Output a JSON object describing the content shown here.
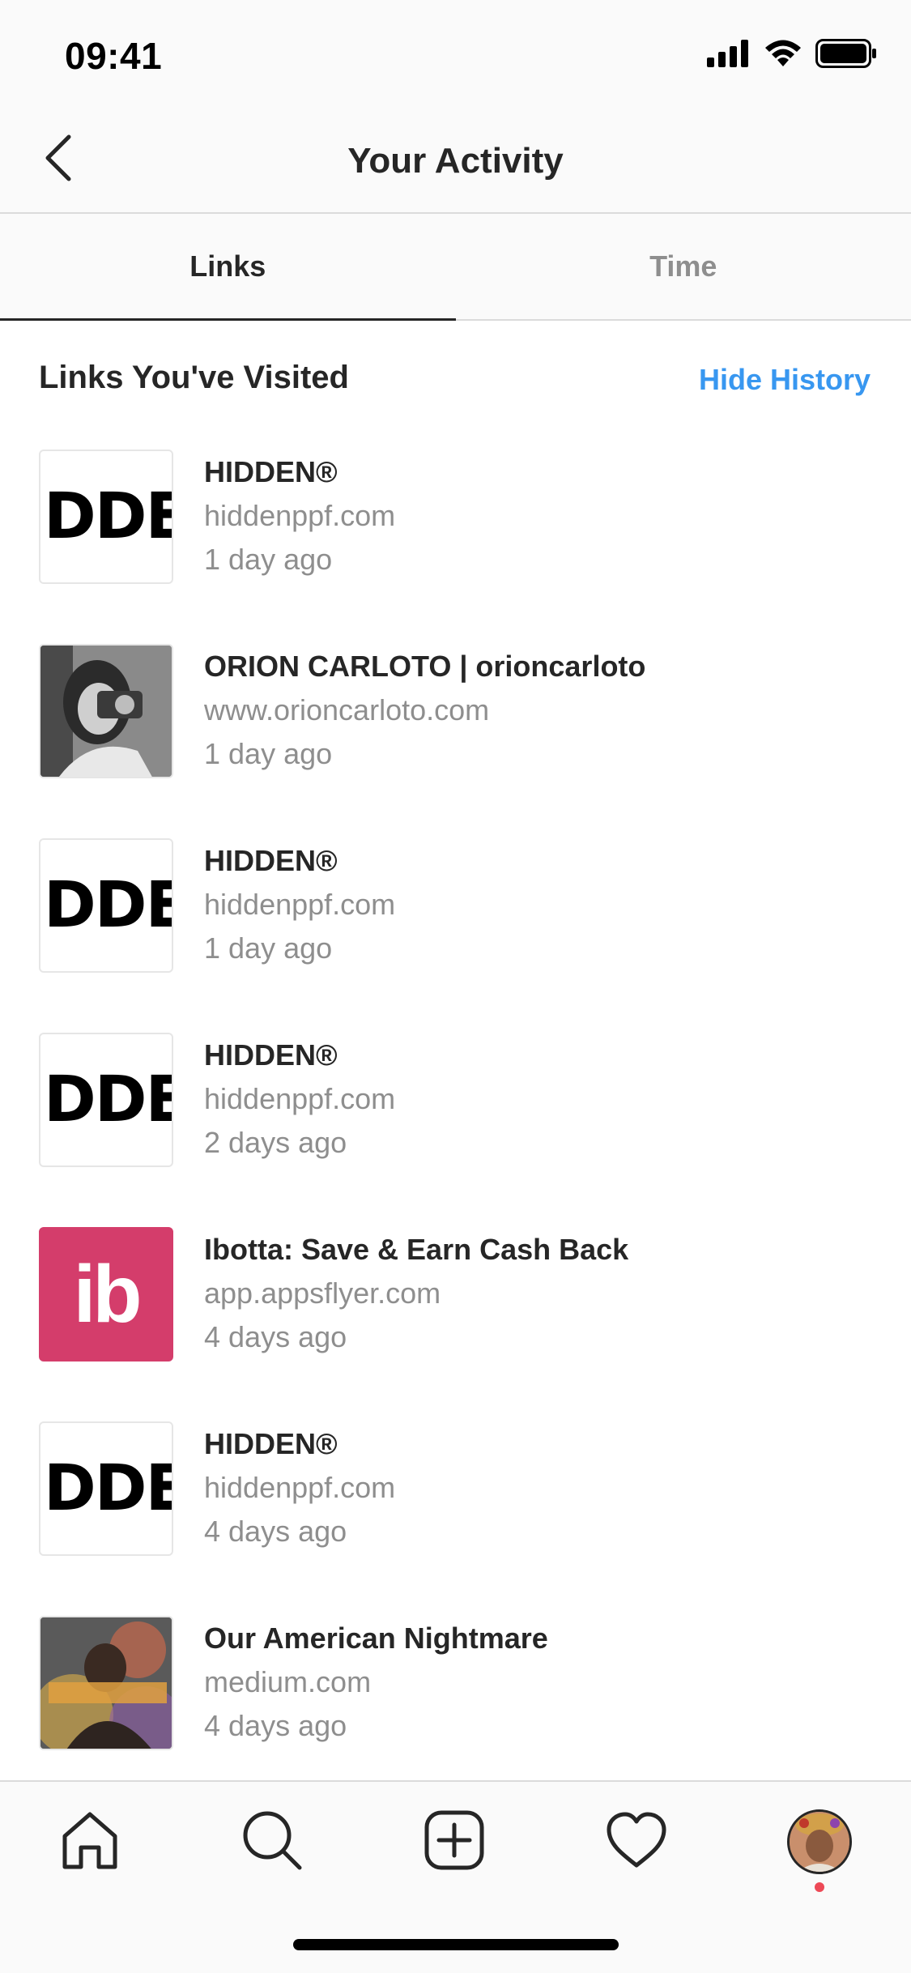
{
  "status_bar": {
    "time": "09:41",
    "icons": [
      "signal-icon",
      "wifi-icon",
      "battery-icon"
    ]
  },
  "header": {
    "title": "Your Activity",
    "back_icon": "chevron-left-icon"
  },
  "tabs": [
    {
      "label": "Links",
      "active": true
    },
    {
      "label": "Time",
      "active": false
    }
  ],
  "section": {
    "title": "Links You've Visited",
    "action": "Hide History"
  },
  "links": [
    {
      "title": "HIDDEN®",
      "domain": "hiddenppf.com",
      "time": "1 day ago",
      "thumb_text": "DDEI"
    },
    {
      "title": "ORION CARLOTO | orioncarloto",
      "domain": "www.orioncarloto.com",
      "time": "1 day ago"
    },
    {
      "title": "HIDDEN®",
      "domain": "hiddenppf.com",
      "time": "1 day ago",
      "thumb_text": "DDEI"
    },
    {
      "title": "HIDDEN®",
      "domain": "hiddenppf.com",
      "time": "2 days ago",
      "thumb_text": "DDEI"
    },
    {
      "title": "Ibotta: Save & Earn Cash Back",
      "domain": "app.appsflyer.com",
      "time": "4 days ago",
      "thumb_text": "ib"
    },
    {
      "title": "HIDDEN®",
      "domain": "hiddenppf.com",
      "time": "4 days ago",
      "thumb_text": "DDEI"
    },
    {
      "title": "Our American Nightmare",
      "domain": "medium.com",
      "time": "4 days ago"
    }
  ],
  "bottom_nav": {
    "items": [
      "home-icon",
      "search-icon",
      "new-post-icon",
      "activity-heart-icon",
      "profile-avatar"
    ]
  },
  "colors": {
    "accent": "#3897f0",
    "ibotta": "#d43d6b",
    "notification": "#ed4956"
  }
}
